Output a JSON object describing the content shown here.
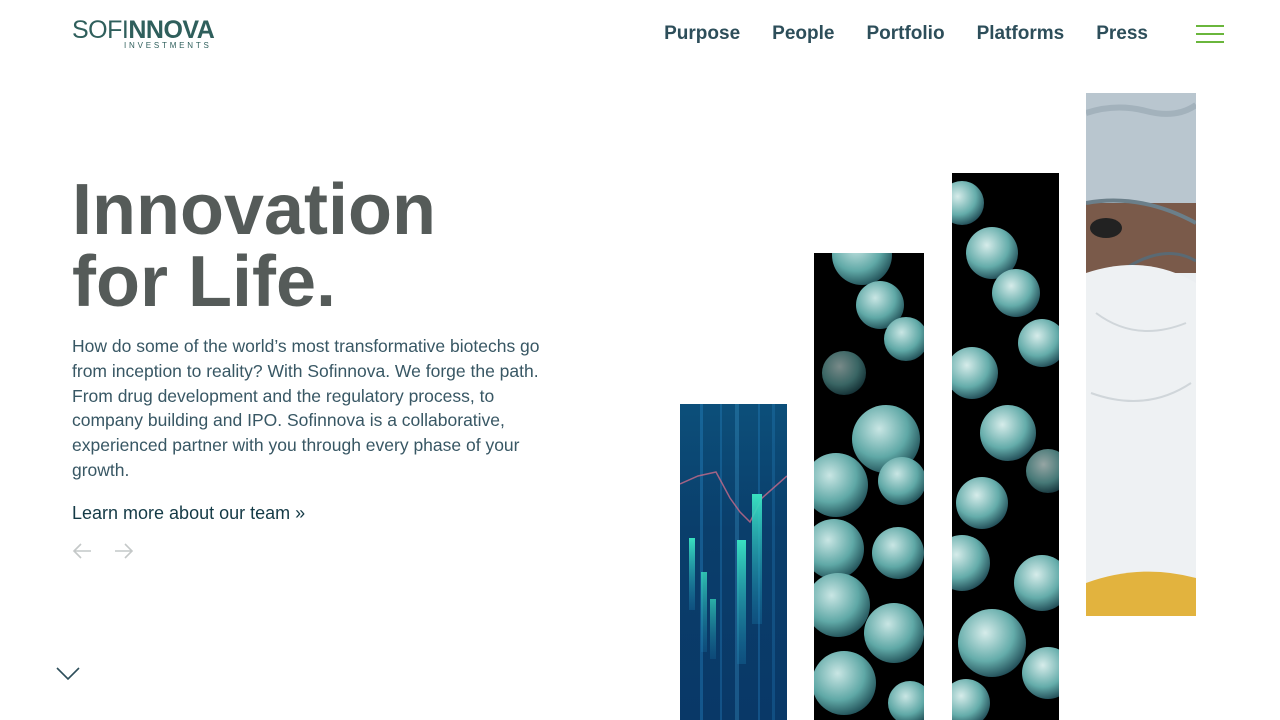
{
  "brand": {
    "name_light": "SOFI",
    "name_bold": "NNOVA",
    "sub": "INVESTMENTS",
    "color": "#2f5f5c"
  },
  "nav": {
    "items": [
      {
        "label": "Purpose"
      },
      {
        "label": "People"
      },
      {
        "label": "Portfolio"
      },
      {
        "label": "Platforms"
      },
      {
        "label": "Press"
      }
    ]
  },
  "menu": {
    "icon": "hamburger-menu-icon",
    "color": "#6ab63c"
  },
  "hero": {
    "title_line1": "Innovation",
    "title_line2": "for Life.",
    "text": "How do some of the world’s most transformative biotechs go from inception to reality? With Sofinnova. We forge the path. From drug development and the regulatory process, to company building and IPO. Sofinnova is a collaborative, experienced partner with you through every phase of your growth.",
    "link": "Learn more about our team »",
    "prev_icon": "arrow-left-icon",
    "next_icon": "arrow-right-icon",
    "scroll_icon": "chevron-down-icon"
  },
  "images": [
    {
      "name": "financial-chart-image"
    },
    {
      "name": "bacteria-chain-image"
    },
    {
      "name": "bacteria-cluster-image"
    },
    {
      "name": "lab-scientist-image"
    }
  ]
}
